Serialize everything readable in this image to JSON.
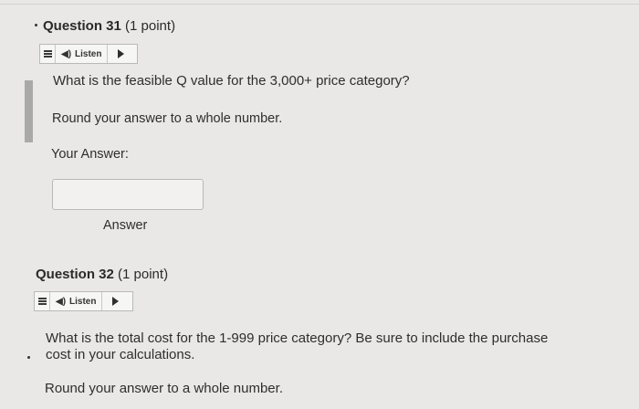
{
  "q31": {
    "number": "Question 31",
    "points": "(1 point)",
    "listen_label": "Listen",
    "prompt": "What is the feasible Q value for the 3,000+ price category?",
    "instruction": "Round your answer to a whole number.",
    "your_answer_label": "Your Answer:",
    "answer_value": "",
    "answer_caption": "Answer"
  },
  "q32": {
    "number": "Question 32",
    "points": "(1 point)",
    "listen_label": "Listen",
    "prompt_line1": "What is the total cost for the 1-999 price category? Be sure to include the purchase",
    "prompt_line2": "cost in your calculations.",
    "instruction": "Round your answer to a whole number."
  },
  "icons": [
    "menu-icon",
    "speaker-icon",
    "play-icon",
    "collapse-dot-icon"
  ]
}
